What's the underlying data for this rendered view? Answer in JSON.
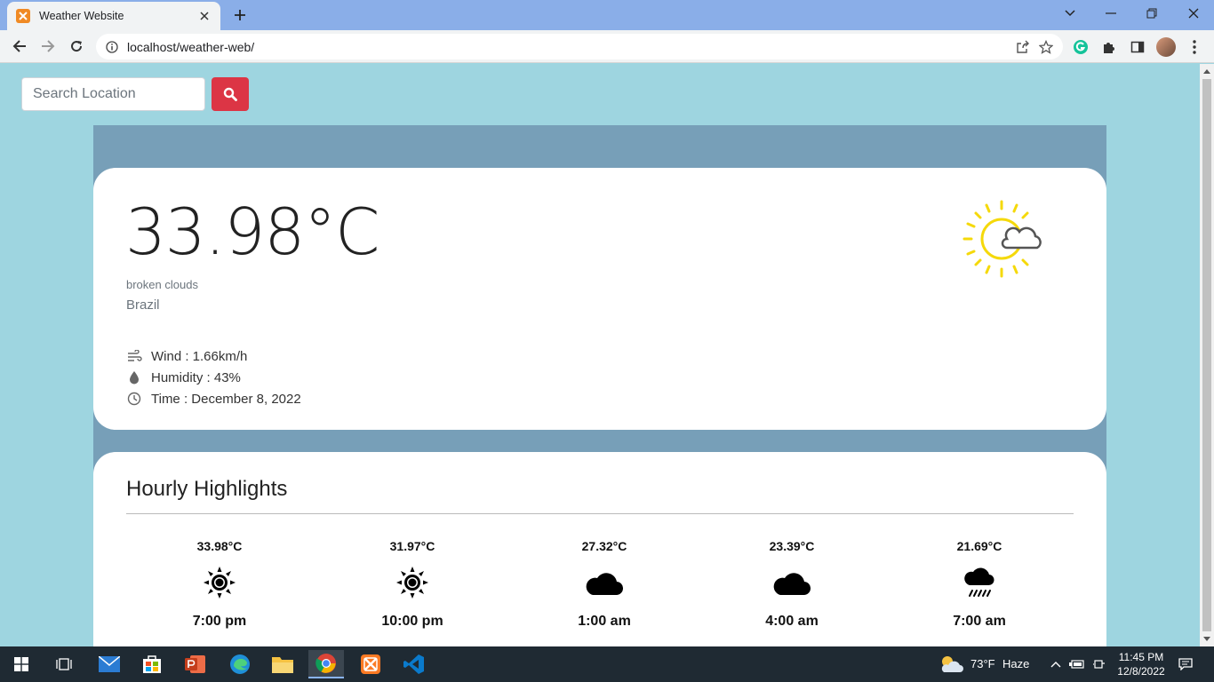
{
  "browser": {
    "tab_title": "Weather Website",
    "url": "localhost/weather-web/"
  },
  "search": {
    "placeholder": "Search Location"
  },
  "current": {
    "temperature": "33.98°C",
    "description": "broken clouds",
    "location": "Brazil",
    "wind": "Wind : 1.66km/h",
    "humidity": "Humidity : 43%",
    "time": "Time : December 8, 2022",
    "icon": "partly-cloudy-sun-icon"
  },
  "hourly": {
    "title": "Hourly Highlights",
    "items": [
      {
        "temp": "33.98°C",
        "icon": "sun-icon",
        "time": "7:00 pm"
      },
      {
        "temp": "31.97°C",
        "icon": "sun-icon",
        "time": "10:00 pm"
      },
      {
        "temp": "27.32°C",
        "icon": "cloud-icon",
        "time": "1:00 am"
      },
      {
        "temp": "23.39°C",
        "icon": "cloud-icon",
        "time": "4:00 am"
      },
      {
        "temp": "21.69°C",
        "icon": "rain-cloud-icon",
        "time": "7:00 am"
      }
    ]
  },
  "taskbar": {
    "weather": "73°F",
    "weather_label": "Haze",
    "clock_time": "11:45 PM",
    "clock_date": "12/8/2022"
  },
  "colors": {
    "page_bg": "#9ed5e0",
    "panel_bg": "#779fb8",
    "search_button": "#dc3545",
    "sun": "#f5d90a"
  }
}
